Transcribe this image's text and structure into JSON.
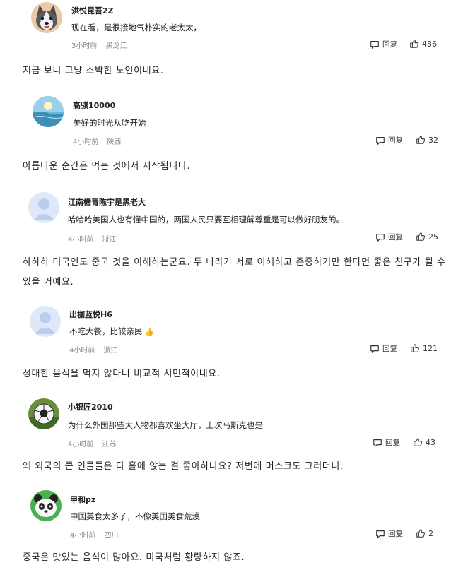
{
  "comments": [
    {
      "username": "洪悦昆吾2Z",
      "text": "现在看，是很接地气朴实的老太太，",
      "time": "3小时前",
      "location": "黑龙江",
      "reply_label": "回复",
      "likes": "436",
      "avatar_icon": "husky-dog-avatar",
      "translation": "지금 보니 그냥 소박한 노인이네요."
    },
    {
      "username": "高骐10000",
      "text": "美好的时光从吃开始",
      "time": "4小时前",
      "location": "陕西",
      "reply_label": "回复",
      "likes": "32",
      "avatar_icon": "sunset-lake-avatar",
      "translation": "아름다운 순간은 먹는 것에서 시작됩니다."
    },
    {
      "username": "江南檐青陈宇是黑老大",
      "text": "哈哈哈美国人也有懂中国的，两国人民只要互相理解尊重是可以做好朋友的。",
      "time": "4小时前",
      "location": "浙江",
      "reply_label": "回复",
      "likes": "25",
      "avatar_icon": "default-user-avatar",
      "translation": "하하하 미국인도 중국 것을 이해하는군요. 두 나라가 서로 이해하고 존중하기만 한다면 좋은 친구가 될 수 있을 거예요."
    },
    {
      "username": "出枷蓝悦H6",
      "text": "不吃大餐，比较亲民",
      "emoji": "👍",
      "time": "4小时前",
      "location": "浙江",
      "reply_label": "回复",
      "likes": "121",
      "avatar_icon": "default-user-avatar",
      "translation": "성대한 음식을 먹지 않다니 비교적 서민적이네요."
    },
    {
      "username": "小银匠2010",
      "text": "为什么外国那些大人物都喜欢坐大厅，上次马斯克也是",
      "time": "4小时前",
      "location": "江苏",
      "reply_label": "回复",
      "likes": "43",
      "avatar_icon": "soccer-ball-avatar",
      "translation": "왜 외국의 큰 인물들은 다 홀에 앉는 걸 좋아하나요? 저번에 머스크도 그러더니."
    },
    {
      "username": "甲和pz",
      "text": "中国美食太多了，不像美国美食荒漠",
      "time": "4小时前",
      "location": "四川",
      "reply_label": "回复",
      "likes": "2",
      "avatar_icon": "panda-avatar",
      "translation": "중국은 맛있는 음식이 많아요. 미국처럼 황량하지 않죠."
    }
  ],
  "colors": {
    "meta_text": "#888888",
    "body_text": "#222222",
    "avatar_default_bg": "#dfe8f8",
    "avatar_default_fg": "#b9cdee"
  }
}
